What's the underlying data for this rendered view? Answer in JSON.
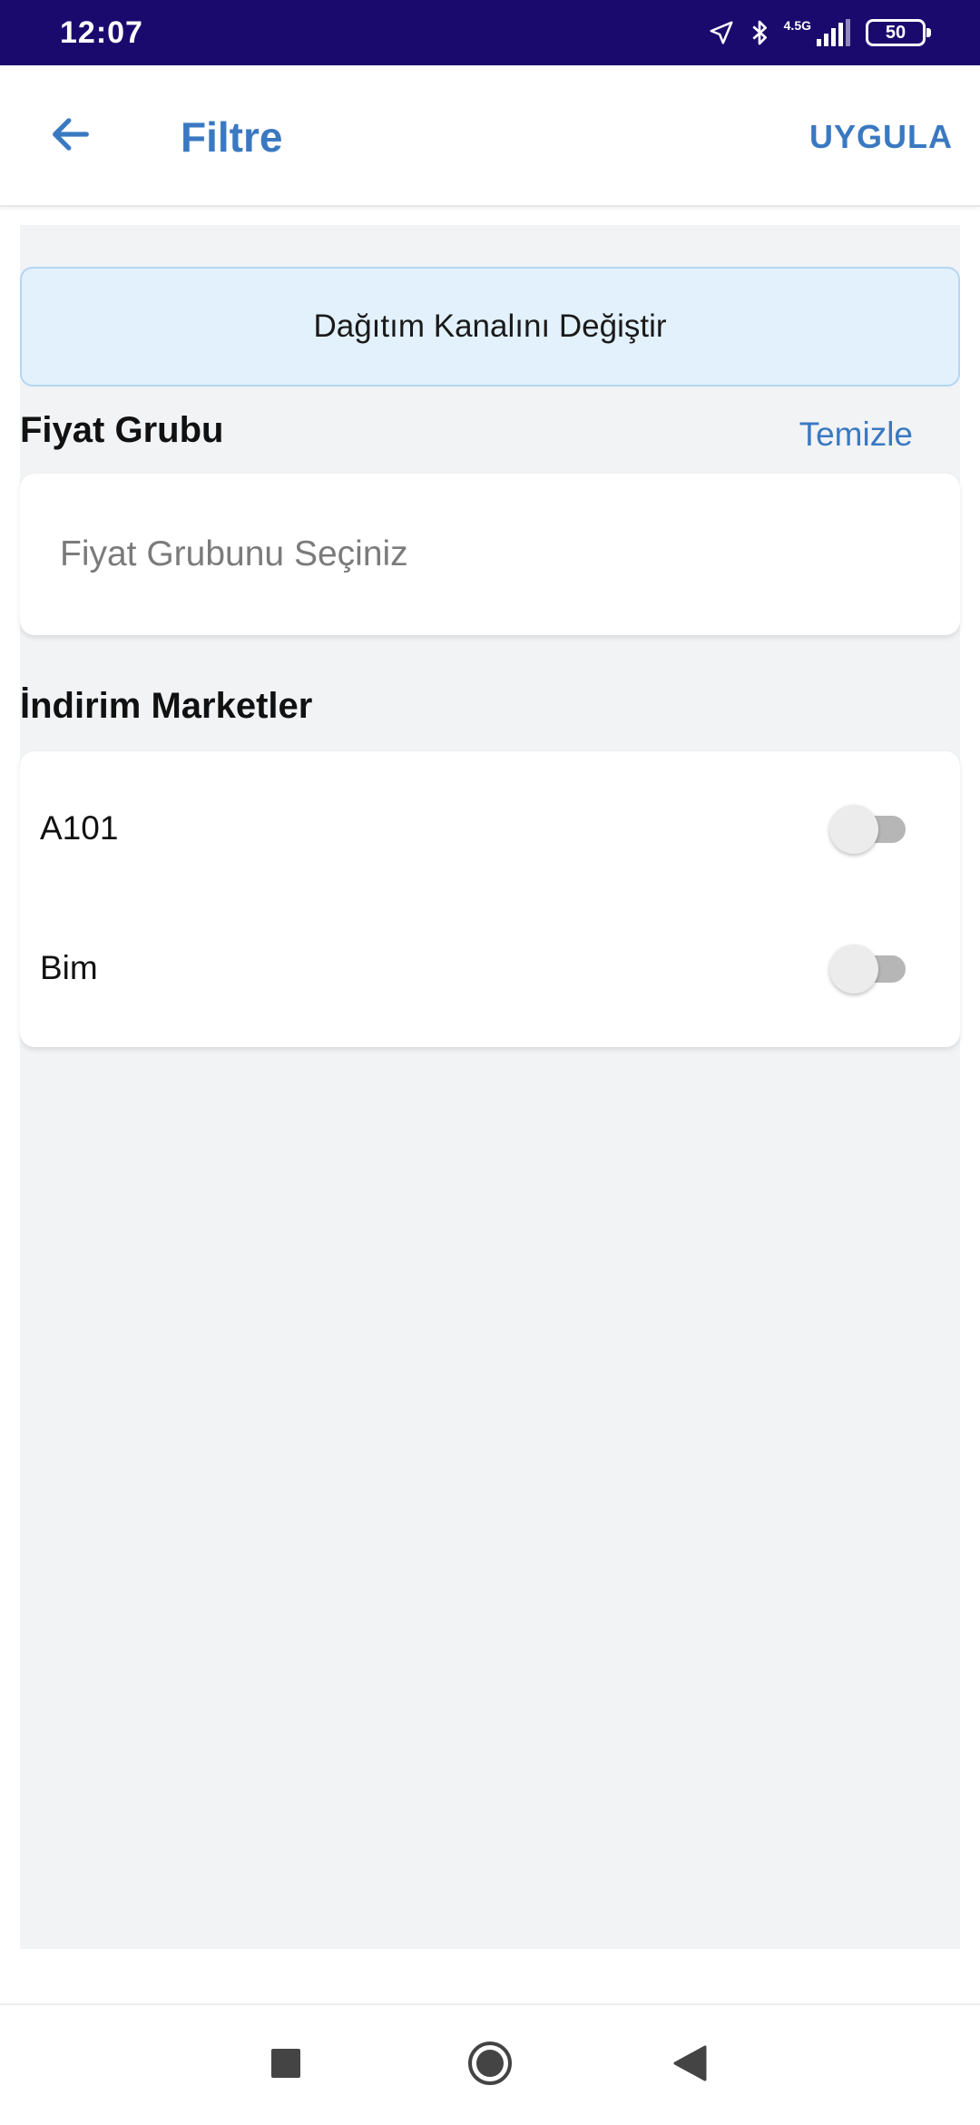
{
  "status_bar": {
    "time": "12:07",
    "network": "4.5G",
    "battery": "50",
    "icons": [
      "location-arrow-icon",
      "bluetooth-icon",
      "signal-icon",
      "battery-icon"
    ]
  },
  "app_bar": {
    "title": "Filtre",
    "apply_label": "UYGULA",
    "back_icon": "arrow-left-icon"
  },
  "channel": {
    "button_label": "Dağıtım Kanalını Değiştir"
  },
  "price_group": {
    "title": "Fiyat Grubu",
    "clear_label": "Temizle",
    "placeholder": "Fiyat Grubunu Seçiniz",
    "value": ""
  },
  "discount_markets": {
    "title": "İndirim Marketler",
    "items": [
      {
        "label": "A101",
        "enabled": false
      },
      {
        "label": "Bim",
        "enabled": false
      }
    ]
  },
  "nav_bar": {
    "icons": [
      "recent-apps-icon",
      "home-icon",
      "back-triangle-icon"
    ]
  },
  "colors": {
    "status_bar": "#1b0a6e",
    "accent": "#3a79c1",
    "content_bg": "#f1f3f5",
    "channel_bg": "#e3f1fc"
  }
}
